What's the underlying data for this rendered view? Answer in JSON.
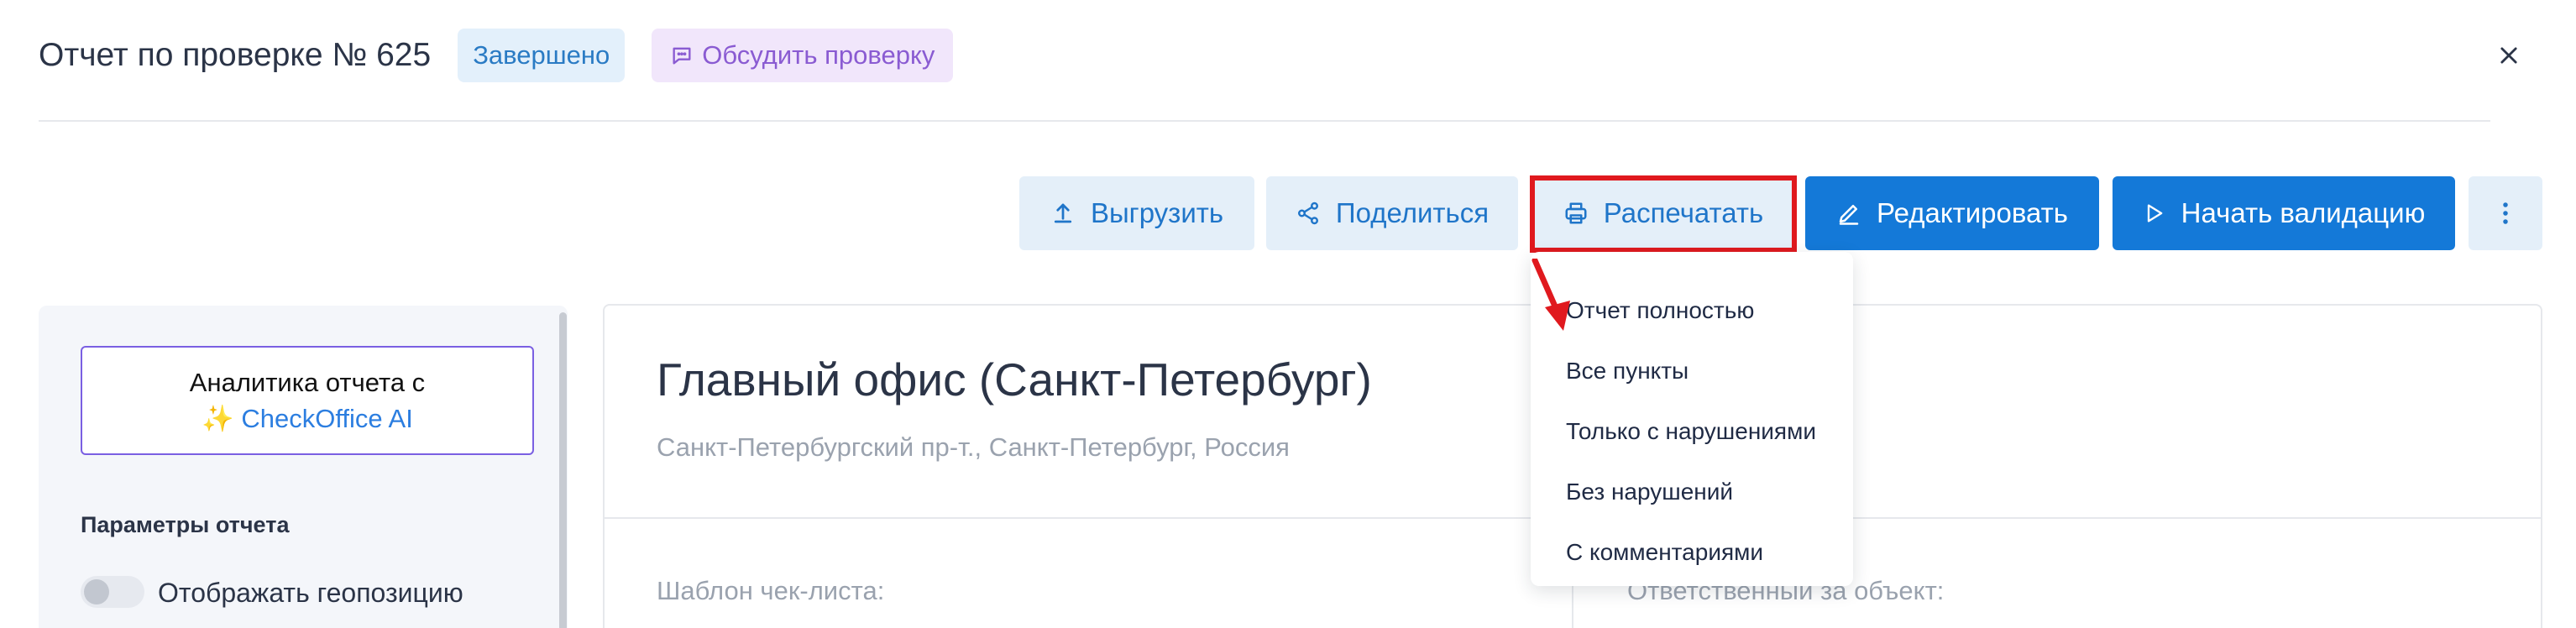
{
  "header": {
    "title": "Отчет по проверке № 625",
    "status_badge": "Завершено",
    "discuss_label": "Обсудить проверку"
  },
  "toolbar": {
    "export_label": "Выгрузить",
    "share_label": "Поделиться",
    "print_label": "Распечатать",
    "edit_label": "Редактировать",
    "validate_label": "Начать валидацию"
  },
  "print_menu": {
    "items": [
      "Отчет полностью",
      "Все пункты",
      "Только с нарушениями",
      "Без нарушений",
      "С комментариями"
    ]
  },
  "sidebar": {
    "ai_line1": "Аналитика отчета с",
    "ai_sparkle": "✨",
    "ai_brand": "CheckOffice AI",
    "params_title": "Параметры отчета",
    "geo_toggle_label": "Отображать геопозицию"
  },
  "main": {
    "object_title": "Главный офис (Санкт-Петербург)",
    "object_address": "Санкт-Петербургский пр-т., Санкт-Петербург, Россия",
    "template_label": "Шаблон чек-листа:",
    "responsible_label": "Ответственный за объект:"
  },
  "colors": {
    "primary": "#1479d8",
    "light_button": "#e4eff9",
    "highlight": "#e0191e",
    "ai_border": "#7a5fe2"
  }
}
